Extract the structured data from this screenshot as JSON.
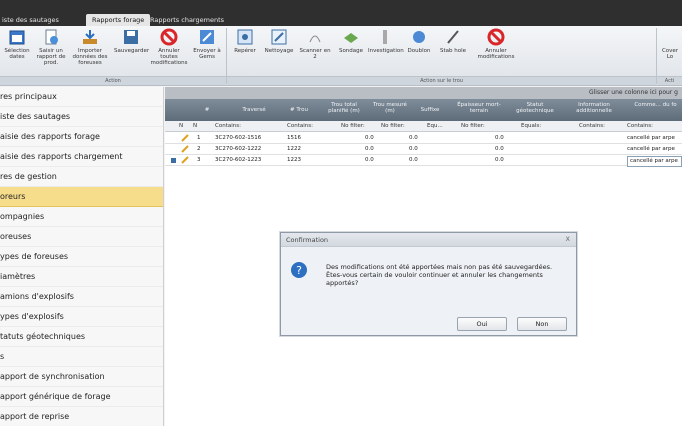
{
  "tabs": [
    "iste des sautages",
    "Rapports forage",
    "Rapports chargements"
  ],
  "ribbon": {
    "buttons": [
      {
        "label": "Sélection dates",
        "icon": "calendar-icon"
      },
      {
        "label": "Saisir un rapport de prod.",
        "icon": "document-add-icon"
      },
      {
        "label": "Importer données des foreuses",
        "icon": "import-icon"
      },
      {
        "label": "Sauvegarder",
        "icon": "save-icon"
      },
      {
        "label": "Annuler toutes modifications",
        "icon": "cancel-icon"
      },
      {
        "label": "Envoyer à Gems",
        "icon": "send-icon"
      },
      {
        "label": "Repérer",
        "icon": "locate-icon"
      },
      {
        "label": "Nettoyage",
        "icon": "clean-icon"
      },
      {
        "label": "Scanner en 2",
        "icon": "scan-icon"
      },
      {
        "label": "Sondage",
        "icon": "probe-icon"
      },
      {
        "label": "Investigation",
        "icon": "investigate-icon"
      },
      {
        "label": "Doublon",
        "icon": "duplicate-icon"
      },
      {
        "label": "Stab hole",
        "icon": "pen-icon"
      },
      {
        "label": "Annuler modifications",
        "icon": "cancel-icon"
      },
      {
        "label": "Cover Lo",
        "icon": "cover-icon"
      }
    ],
    "group_labels": [
      "Action",
      "Action sur le trou",
      "Acti"
    ]
  },
  "nav": {
    "items": [
      "res principaux",
      "iste des sautages",
      "aisie des rapports forage",
      "aisie des rapports chargement",
      "res de gestion",
      "oreurs",
      "ompagnies",
      "oreuses",
      "ypes de foreuses",
      "iamètres",
      "amions d'explosifs",
      "ypes d'explosifs",
      "tatuts géotechniques",
      "s",
      "apport de synchronisation",
      "apport générique de forage",
      "apport de reprise"
    ],
    "selected_index": 5
  },
  "grid": {
    "group_hint": "Glisser une colonne ici pour g",
    "headers": [
      "#",
      "Traversé",
      "# Trou",
      "Trou total planifié (m)",
      "Trou mesuré (m)",
      "Suffixe",
      "Épaisseur mort-terrain",
      "Statut géotechnique",
      "Information additionnelle",
      "Comme... du fo"
    ],
    "filters": [
      "N",
      "N",
      "Contains:",
      "Contains:",
      "No filter:",
      "No filter:",
      "Equ...",
      "No filter:",
      "Equals:",
      "Contains:",
      "Contains:"
    ],
    "rows": [
      {
        "num": "1",
        "traverse": "3C270-602-1516",
        "trou": "1516",
        "planifie": "0.0",
        "mesure": "0.0",
        "epaisseur": "0.0",
        "comment": "cancellé par arpe"
      },
      {
        "num": "2",
        "traverse": "3C270-602-1222",
        "trou": "1222",
        "planifie": "0.0",
        "mesure": "0.0",
        "epaisseur": "0.0",
        "comment": "cancellé par arpe"
      },
      {
        "num": "3",
        "traverse": "3C270-602-1223",
        "trou": "1223",
        "planifie": "0.0",
        "mesure": "0.0",
        "epaisseur": "0.0",
        "comment": "cancellé par arpe"
      }
    ]
  },
  "dialog": {
    "title": "Confirmation",
    "close": "X",
    "message": "Des modifications ont été apportées mais non pas été sauvegardées. Êtes-vous certain de vouloir continuer et annuler les changements apportés?",
    "yes": "Oui",
    "no": "Non"
  },
  "colors": {
    "selected_nav": "#f6dd8b",
    "header": "#6b7987",
    "dialog_icon": "#2d6fc0"
  }
}
